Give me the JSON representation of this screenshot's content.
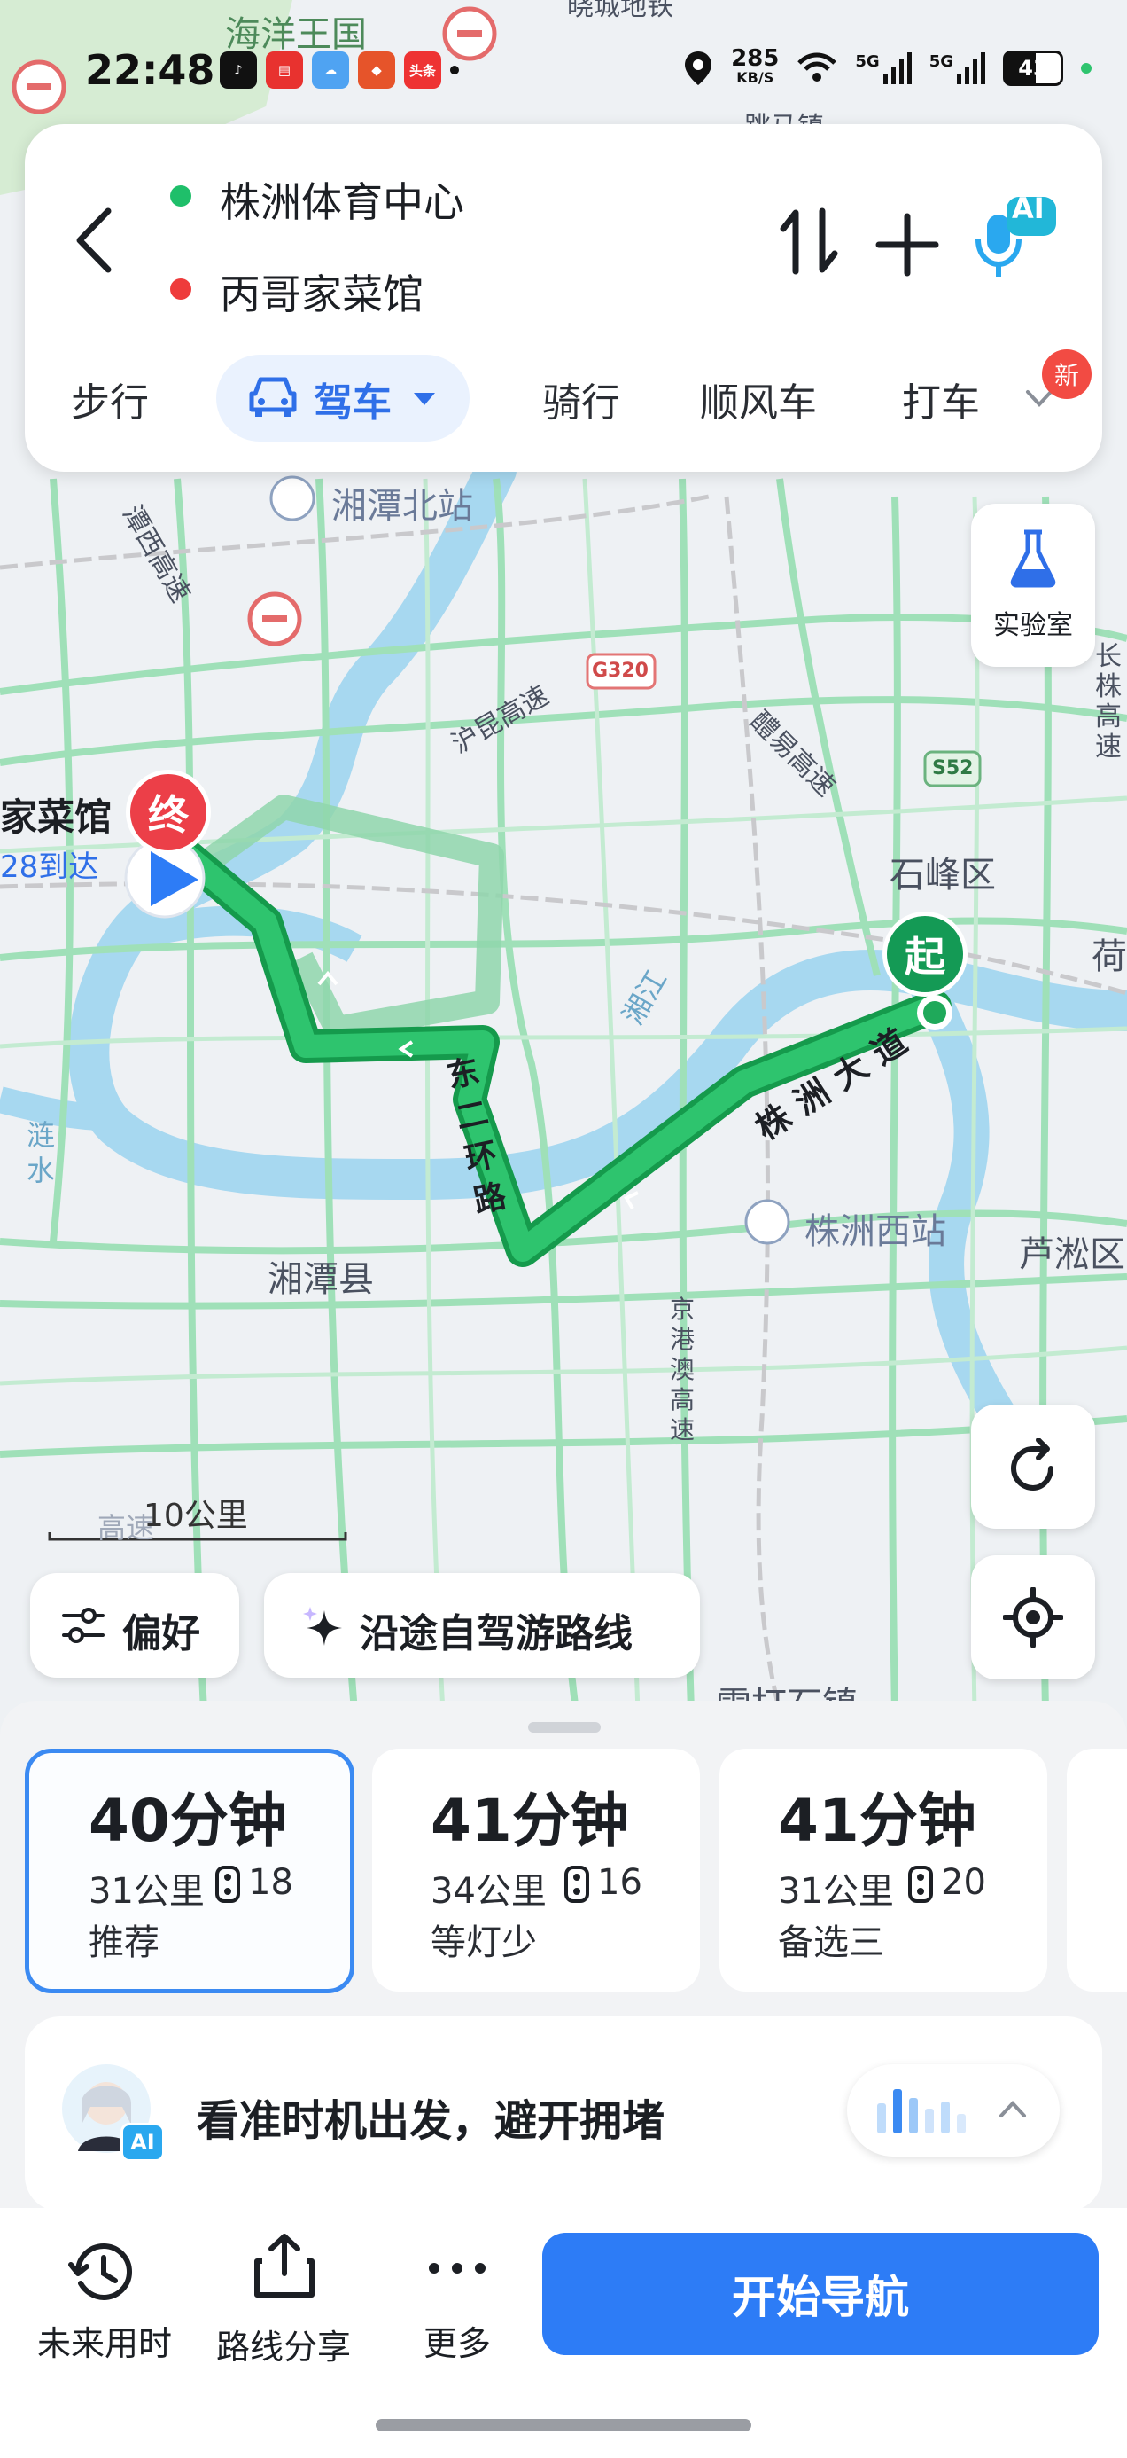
{
  "status_bar": {
    "time": "22:48",
    "app_icons": [
      "tiktok-icon",
      "news-app-icon",
      "weather-icon",
      "game-app-icon",
      "toutiao-icon"
    ],
    "app_icon_texts": [
      "",
      "",
      "",
      "",
      "头条"
    ],
    "net_speed_value": "285",
    "net_speed_unit": "KB/S",
    "network_1": "5G",
    "network_2": "5G",
    "battery": "43"
  },
  "route_header": {
    "origin": "株洲体育中心",
    "destination": "丙哥家菜馆",
    "origin_color": "#1fbf6a",
    "destination_color": "#ee3b3b",
    "ai_badge": "AI"
  },
  "mode_tabs": {
    "walk": "步行",
    "drive": "驾车",
    "bike": "骑行",
    "carpool": "顺风车",
    "taxi": "打车",
    "new_badge": "新"
  },
  "map": {
    "lab_label": "实验室",
    "labels": {
      "top_partial_1": "海洋王国",
      "top_partial_2": "晓城地铁",
      "top_partial_3": "跳马镇",
      "xiangtan_north": "湘潭北站",
      "xiangtan_west": "潭西高速",
      "g320": "G320",
      "hukun": "沪昆高速",
      "liling": "醴易高速",
      "s52": "S52",
      "shifeng": "石峰区",
      "he": "荷",
      "changzhu": "长株高速",
      "dest_name": "家菜馆",
      "dest_eta": "28到达",
      "dongerhuan": "东二环路",
      "zhuzhou_avenue": "株洲大道",
      "xiangjiang": "湘江",
      "lianshui": "涟水",
      "zhuzhou_west": "株洲西站",
      "xiangtan_county": "湘潭县",
      "lusong": "芦淞区",
      "jinggangao": "京港澳高速",
      "leidashi": "雷打石镇",
      "gaosu_partial": "高速"
    },
    "start_marker": "起",
    "end_marker": "终",
    "scale": "10公里",
    "route_color": "#23b45d",
    "alt_route_color": "#8fd6ac"
  },
  "actions": {
    "preference": "偏好",
    "self_drive": "沿途自驾游路线"
  },
  "routes": [
    {
      "time": "40分钟",
      "distance": "31公里",
      "lights": "18",
      "tag": "推荐"
    },
    {
      "time": "41分钟",
      "distance": "34公里",
      "lights": "16",
      "tag": "等灯少"
    },
    {
      "time": "41分钟",
      "distance": "31公里",
      "lights": "20",
      "tag": "备选三"
    }
  ],
  "ai_assistant": {
    "badge": "AI",
    "message": "看准时机出发，避开拥堵"
  },
  "bottom_bar": {
    "future_time": "未来用时",
    "share_route": "路线分享",
    "more": "更多",
    "start_nav": "开始导航"
  }
}
